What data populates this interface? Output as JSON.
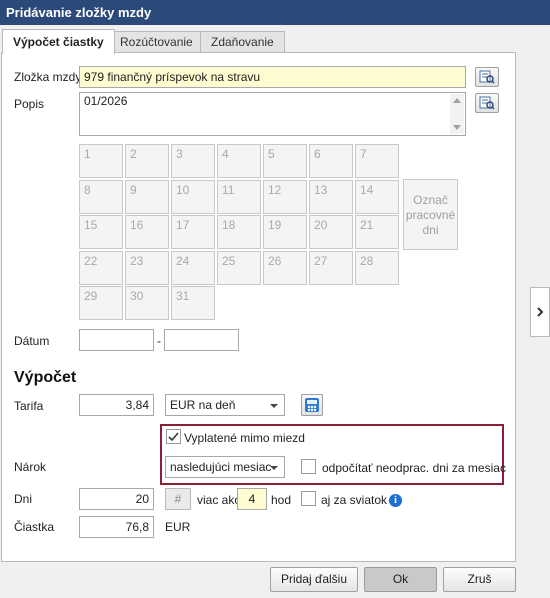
{
  "window": {
    "title": "Pridávanie zložky mzdy"
  },
  "tabs": [
    {
      "label": "Výpočet čiastky"
    },
    {
      "label": "Rozúčtovanie"
    },
    {
      "label": "Zdaňovanie"
    }
  ],
  "form": {
    "component_label": "Zložka mzdy",
    "component_value": "979  finančný príspevok na stravu",
    "description_label": "Popis",
    "description_value": "01/2026",
    "days": [
      "1",
      "2",
      "3",
      "4",
      "5",
      "6",
      "7",
      "8",
      "9",
      "10",
      "11",
      "12",
      "13",
      "14",
      "15",
      "16",
      "17",
      "18",
      "19",
      "20",
      "21",
      "22",
      "23",
      "24",
      "25",
      "26",
      "27",
      "28",
      "29",
      "30",
      "31"
    ],
    "mark_days_label": [
      "Označ",
      "pracovné",
      "dni"
    ],
    "date_label": "Dátum",
    "date_from": "",
    "date_separator": "-",
    "date_to": ""
  },
  "calc": {
    "section_title": "Výpočet",
    "rate_label": "Tarifa",
    "rate_value": "3,84",
    "rate_unit": "EUR na deň",
    "paid_outside_label": "Vyplatené mimo miezd",
    "paid_outside_checked": true,
    "entitlement_label": "Nárok",
    "entitlement_value": "nasledujúci mesiac",
    "deduct_label": "odpočítať neodprac. dni za mesiac",
    "deduct_checked": false,
    "days_label": "Dni",
    "days_value": "20",
    "hash_symbol": "#",
    "more_than_label": "viac ako",
    "hours_value": "4",
    "hours_unit": "hod",
    "holiday_label": "aj za sviatok",
    "holiday_checked": false,
    "amount_label": "Čiastka",
    "amount_value": "76,8",
    "amount_unit": "EUR"
  },
  "buttons": {
    "add_next": "Pridaj ďalšiu",
    "ok": "Ok",
    "cancel": "Zruš"
  },
  "colors": {
    "titlebar": "#2b4a7a",
    "highlight_border": "#8b1f3a",
    "yellow_field": "#fffbd0",
    "info": "#1e6fd0"
  }
}
